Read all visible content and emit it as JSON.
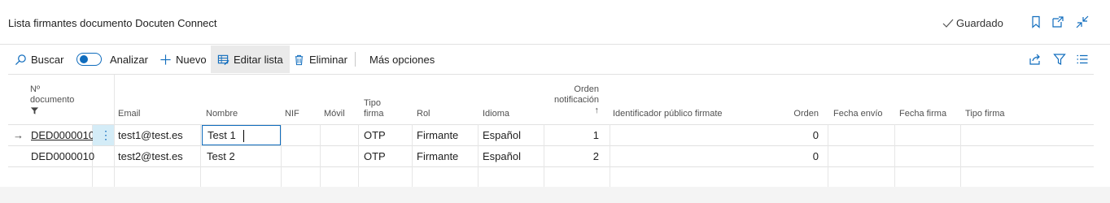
{
  "header": {
    "title": "Lista firmantes documento Docuten Connect",
    "saved_label": "Guardado"
  },
  "toolbar": {
    "search": "Buscar",
    "analyze": "Analizar",
    "new": "Nuevo",
    "edit_list": "Editar lista",
    "delete": "Eliminar",
    "more": "Más opciones"
  },
  "columns": {
    "doc_no_line1": "Nº",
    "doc_no_line2": "documento",
    "email": "Email",
    "name": "Nombre",
    "nif": "NIF",
    "mobile": "Móvil",
    "sign_type_line1": "Tipo",
    "sign_type_line2": "firma",
    "role": "Rol",
    "language": "Idioma",
    "notif_order_line1": "Orden",
    "notif_order_line2": "notificación",
    "sort_arrow": "↑",
    "public_id": "Identificador público firmate",
    "order": "Orden",
    "send_date": "Fecha envío",
    "sign_date": "Fecha firma",
    "sign_type2": "Tipo firma"
  },
  "rows": [
    {
      "marker": "→",
      "doc_no": "DED0000010",
      "email": "test1@test.es",
      "name": "Test 1",
      "nif": "",
      "mobile": "",
      "sign_type": "OTP",
      "role": "Firmante",
      "language": "Español",
      "notif_order": "1",
      "public_id": "",
      "order": "0",
      "send_date": "",
      "sign_date": "",
      "sign_type2": ""
    },
    {
      "marker": "",
      "doc_no": "DED0000010",
      "email": "test2@test.es",
      "name": "Test 2",
      "nif": "",
      "mobile": "",
      "sign_type": "OTP",
      "role": "Firmante",
      "language": "Español",
      "notif_order": "2",
      "public_id": "",
      "order": "0",
      "send_date": "",
      "sign_date": "",
      "sign_type2": ""
    }
  ],
  "row_menu_glyph": "⋮",
  "colors": {
    "accent": "#0f6cbd",
    "selected_cell": "#d4ecf7",
    "border": "#e1e1e1"
  }
}
